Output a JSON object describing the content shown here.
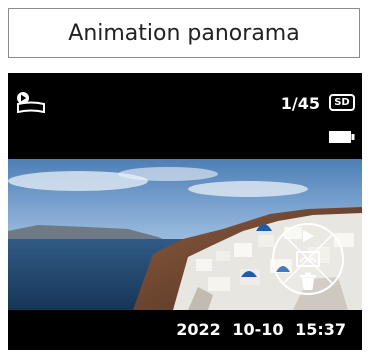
{
  "title": "Animation panorama",
  "screen": {
    "mode_icon": "animation-panorama-icon",
    "counter": "1/45",
    "storage_badge": "SD",
    "battery_icon": "battery-icon",
    "photo": "santorini-panorama-photo",
    "nav_controls": {
      "top": "play-icon",
      "center": "panorama-icon",
      "bottom": "trash-icon"
    },
    "datetime": "2022 10-10 15:37"
  },
  "colors": {
    "screen_bg": "#000000",
    "text": "#ffffff",
    "frame_border": "#8c8c8c"
  }
}
